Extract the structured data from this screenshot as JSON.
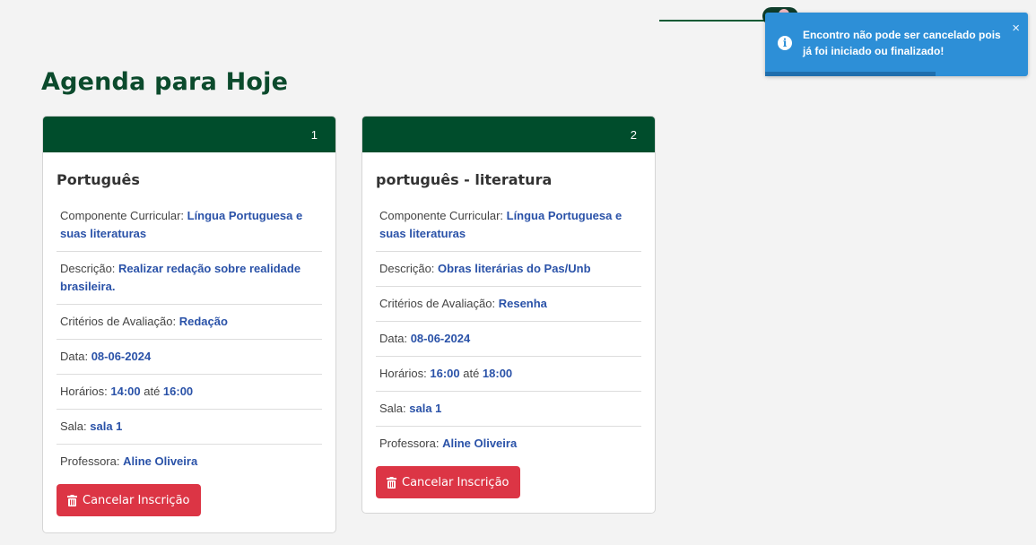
{
  "page": {
    "title": "Agenda para Hoje"
  },
  "labels": {
    "componente": "Componente Curricular: ",
    "descricao": "Descrição: ",
    "criterios": "Critérios de Avaliação: ",
    "data": "Data: ",
    "horarios": "Horários: ",
    "ate": " até ",
    "sala": "Sala: ",
    "professora": "Professora: "
  },
  "cards": [
    {
      "number": "1",
      "title": "Português",
      "componente": "Língua Portuguesa e suas literaturas",
      "descricao": "Realizar redação sobre realidade brasileira.",
      "criterios": "Redação",
      "data": "08-06-2024",
      "hora_inicio": "14:00",
      "hora_fim": "16:00",
      "sala": "sala 1",
      "professora": "Aline Oliveira",
      "button_label": "Cancelar Inscrição"
    },
    {
      "number": "2",
      "title": "português - literatura",
      "componente": "Língua Portuguesa e suas literaturas",
      "descricao": "Obras literárias do Pas/Unb",
      "criterios": "Resenha",
      "data": "08-06-2024",
      "hora_inicio": "16:00",
      "hora_fim": "18:00",
      "sala": "sala 1",
      "professora": "Aline Oliveira",
      "button_label": "Cancelar Inscrição"
    }
  ],
  "toast": {
    "message": "Encontro não pode ser cancelado pois já foi iniciado ou finalizado!",
    "close_symbol": "×",
    "info_symbol": "i",
    "progress": 0.65,
    "color": "#2d8fd7"
  },
  "colors": {
    "header_green": "#004d2c",
    "title_green": "#0b4a2c",
    "value_blue": "#2a52a8",
    "danger": "#dc3545"
  },
  "icons": {
    "button": "trash-icon",
    "toast": "info-icon",
    "toast_close": "close-icon"
  }
}
